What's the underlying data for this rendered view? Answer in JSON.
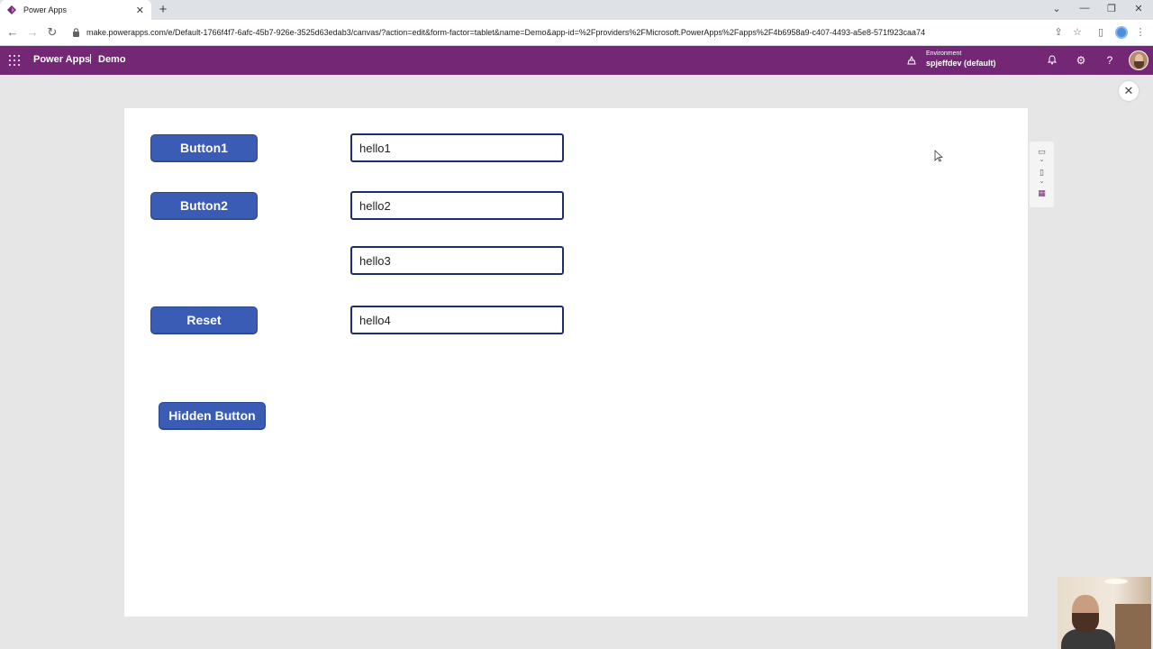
{
  "browser": {
    "tab_title": "Power Apps",
    "tab_close": "✕",
    "new_tab": "+",
    "url": "make.powerapps.com/e/Default-1766f4f7-6afc-45b7-926e-3525d63edab3/canvas/?action=edit&form-factor=tablet&name=Demo&app-id=%2Fproviders%2FMicrosoft.PowerApps%2Fapps%2F4b6958a9-c407-4493-a5e8-571f923caa74"
  },
  "header": {
    "brand": "Power Apps",
    "separator": "|",
    "app_name": "Demo",
    "environment_label": "Environment",
    "environment_value": "spjeffdev (default)",
    "background_color": "#742774"
  },
  "canvas": {
    "buttons": {
      "button1": "Button1",
      "button2": "Button2",
      "reset": "Reset",
      "hidden": "Hidden Button"
    },
    "inputs": {
      "input1": "hello1",
      "input2": "hello2",
      "input3": "hello3",
      "input4": "hello4"
    },
    "button_color": "#3a5cb5",
    "input_border_color": "#1f2e6b"
  },
  "icons": {
    "back": "back-arrow-icon",
    "forward": "forward-arrow-icon",
    "reload": "reload-icon",
    "lock": "lock-icon",
    "share": "share-icon",
    "star": "bookmark-star-icon",
    "sidebar": "side-panel-icon",
    "menu": "kebab-menu-icon",
    "waffle": "app-launcher-icon",
    "environment": "environment-icon",
    "bell": "notification-bell-icon",
    "gear": "settings-gear-icon",
    "help": "help-icon",
    "close": "close-icon"
  }
}
